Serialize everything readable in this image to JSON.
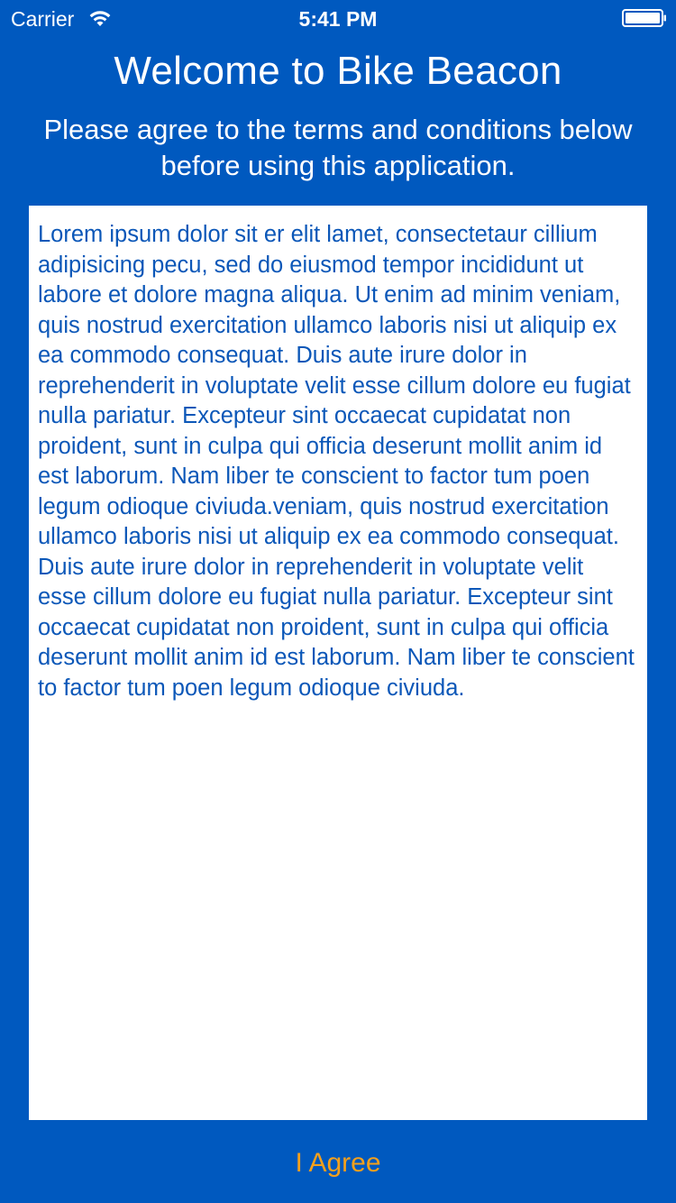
{
  "status_bar": {
    "carrier": "Carrier",
    "time": "5:41 PM",
    "wifi_icon": "wifi-icon",
    "battery_icon": "battery-icon"
  },
  "header": {
    "title": "Welcome to Bike Beacon",
    "subtitle": "Please agree to the terms and conditions below before using this application."
  },
  "terms": {
    "text": "Lorem ipsum dolor sit er elit lamet, consectetaur cillium adipisicing pecu, sed do eiusmod tempor incididunt ut labore et dolore magna aliqua. Ut enim ad minim veniam, quis nostrud exercitation ullamco laboris nisi ut aliquip ex ea commodo consequat. Duis aute irure dolor in reprehenderit in voluptate velit esse cillum dolore eu fugiat nulla pariatur. Excepteur sint occaecat cupidatat non proident, sunt in culpa qui officia deserunt mollit anim id est laborum. Nam liber te conscient to factor tum poen legum odioque civiuda.veniam, quis nostrud exercitation ullamco laboris nisi ut aliquip ex ea commodo consequat. Duis aute irure dolor in reprehenderit in voluptate velit esse cillum dolore eu fugiat nulla pariatur. Excepteur sint occaecat cupidatat non proident, sunt in culpa qui officia deserunt mollit anim id est laborum. Nam liber te conscient to factor tum poen legum odioque civiuda."
  },
  "footer": {
    "agree_label": "I Agree"
  },
  "colors": {
    "background": "#0059BF",
    "terms_text": "#0B57B8",
    "agree_button": "#F4A01C"
  }
}
